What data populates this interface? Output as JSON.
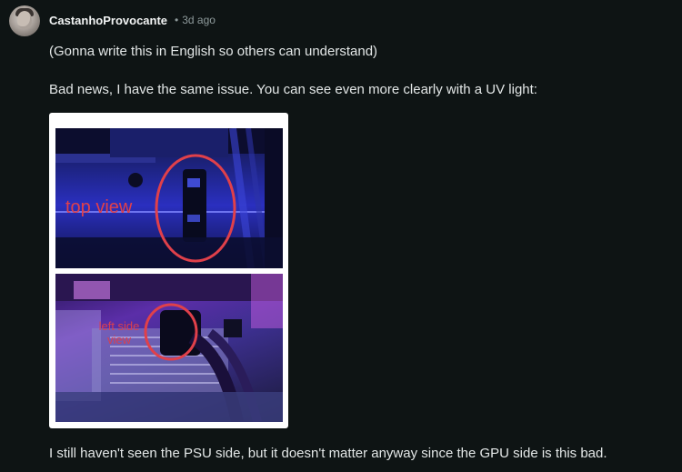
{
  "comment": {
    "author": "CastanhoProvocante",
    "separator": "•",
    "timestamp": "3d ago",
    "paragraphs": [
      "(Gonna write this in English so others can understand)",
      "Bad news, I have the same issue. You can see even more clearly with a UV light:",
      "I still haven't seen the PSU side, but it doesn't matter anyway since the GPU side is this bad."
    ],
    "image": {
      "top_annotation": "top view",
      "bottom_annotation": "left side view"
    }
  },
  "colors": {
    "background": "#0e1414",
    "text": "#e3e7e7",
    "meta": "#8e9a9b",
    "annotation_red": "#e0404a"
  }
}
